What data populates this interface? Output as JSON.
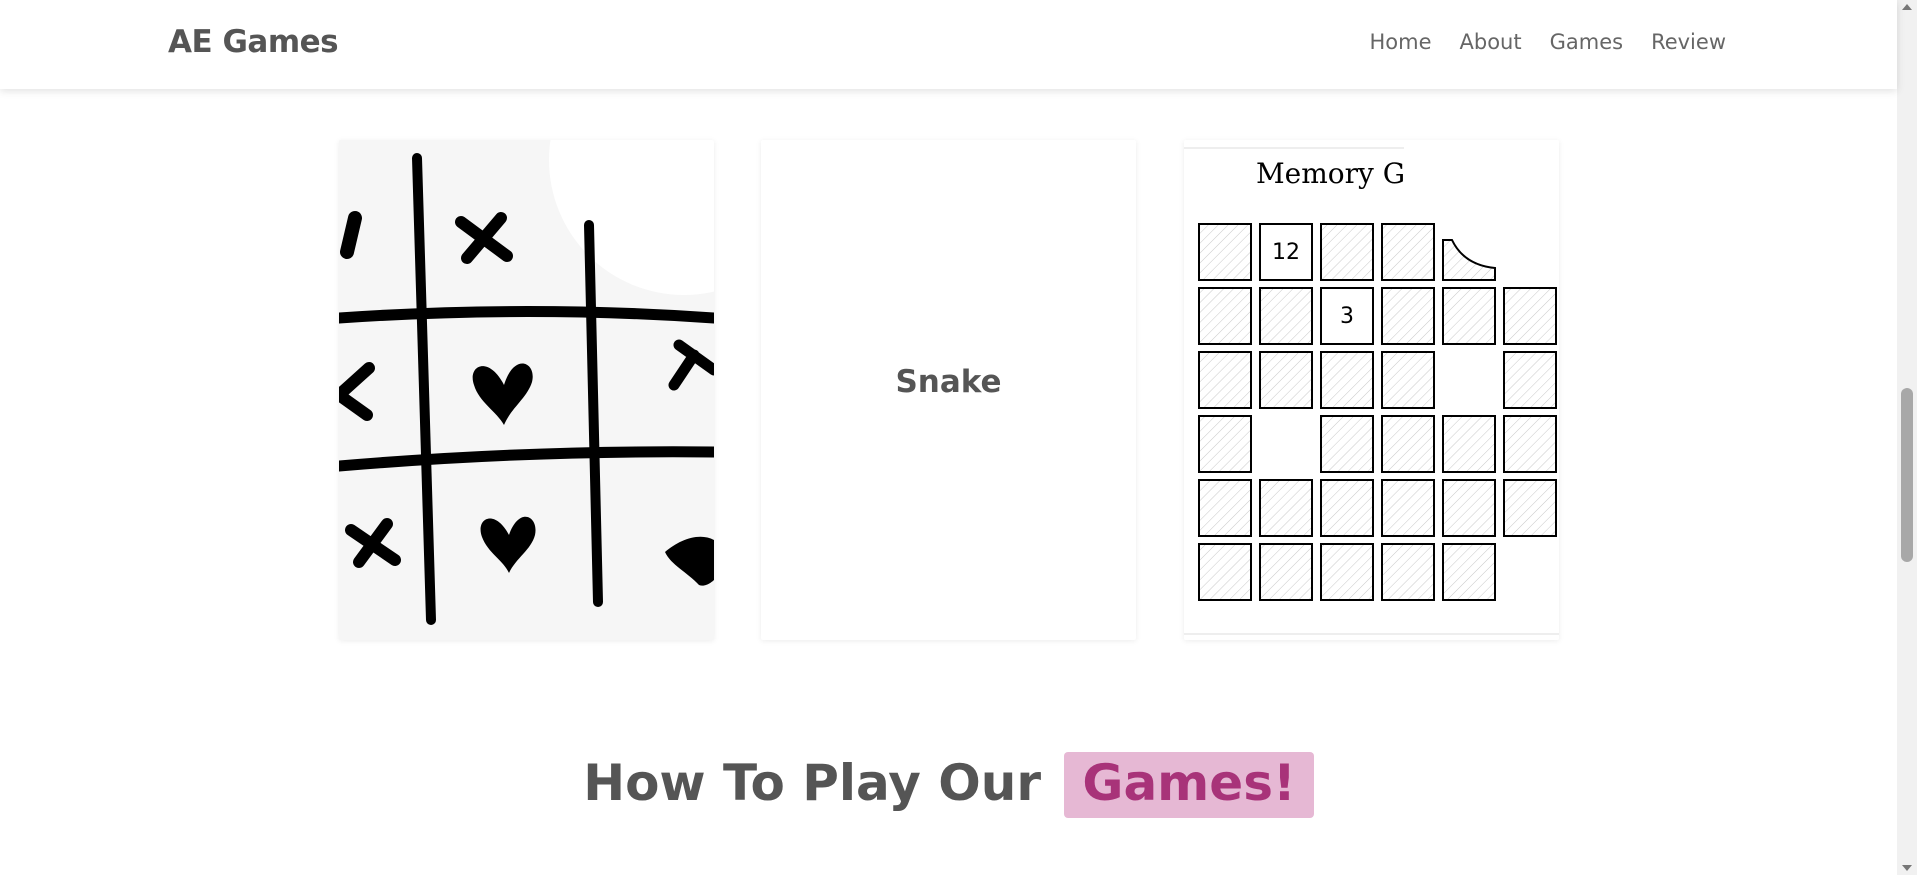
{
  "header": {
    "brand": "AE Games",
    "nav": [
      "Home",
      "About",
      "Games",
      "Review"
    ]
  },
  "games": {
    "tictactoe": {
      "icon": "tic-tac-toe-hearts-image"
    },
    "snake": {
      "label": "Snake"
    },
    "memory": {
      "title": "Memory G",
      "revealed_numbers": [
        "12",
        "3"
      ]
    }
  },
  "section": {
    "heading_part1": "How To Play Our",
    "heading_highlight": "Games!"
  },
  "colors": {
    "accent": "#a83379",
    "highlight_bg": "#e6b8d4",
    "text": "#555555"
  }
}
